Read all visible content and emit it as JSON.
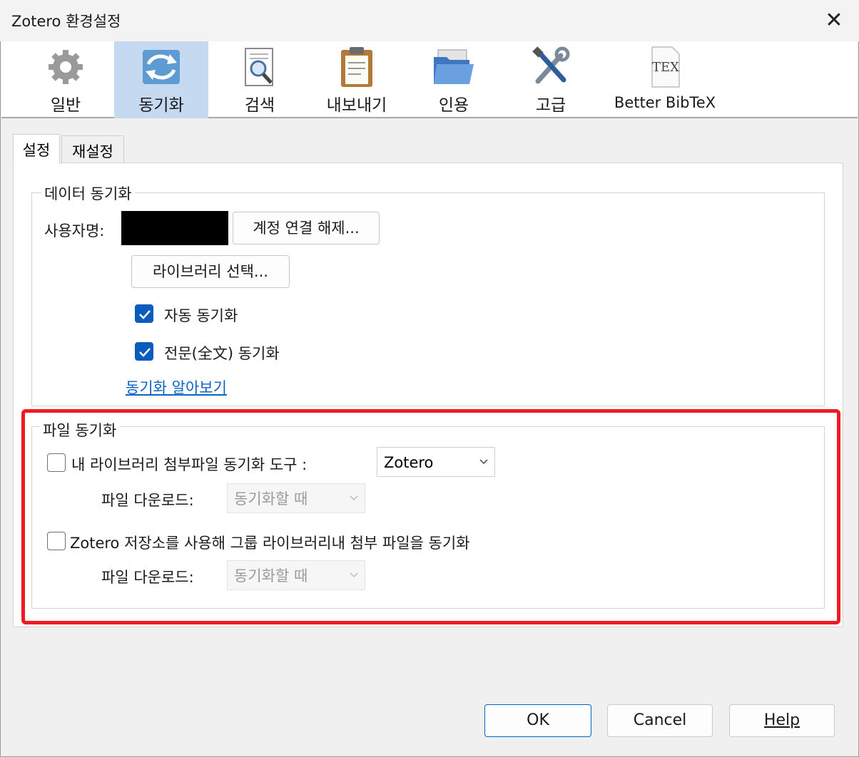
{
  "window": {
    "title": "Zotero 환경설정",
    "close_glyph": "✕"
  },
  "toolbar": {
    "items": [
      {
        "label": "일반",
        "icon": "gear-icon"
      },
      {
        "label": "동기화",
        "icon": "sync-icon"
      },
      {
        "label": "검색",
        "icon": "search-document-icon"
      },
      {
        "label": "내보내기",
        "icon": "clipboard-icon"
      },
      {
        "label": "인용",
        "icon": "folder-icon"
      },
      {
        "label": "고급",
        "icon": "tools-icon"
      },
      {
        "label": "Better BibTeX",
        "icon": "tex-document-icon",
        "icon_text": "TEX"
      }
    ],
    "selected": "동기화"
  },
  "tabs": [
    {
      "label": "설정",
      "active": true
    },
    {
      "label": "재설정",
      "active": false
    }
  ],
  "data_sync": {
    "legend": "데이터 동기화",
    "username_label": "사용자명:",
    "unlink_button": "계정 연결 해제...",
    "choose_libraries_button": "라이브러리 선택...",
    "auto_sync": {
      "label": "자동 동기화",
      "checked": true
    },
    "fulltext_sync": {
      "label": "전문(全文) 동기화",
      "checked": true
    },
    "learn_link": "동기화 알아보기"
  },
  "file_sync": {
    "legend": "파일 동기화",
    "my_library": {
      "label": "내 라이브러리 첨부파일 동기화 도구 :",
      "checked": false,
      "tool_value": "Zotero"
    },
    "download1": {
      "label": "파일 다운로드:",
      "value": "동기화할 때"
    },
    "groups": {
      "label": "Zotero 저장소를 사용해 그룹 라이브러리내 첨부 파일을 동기화",
      "checked": false
    },
    "download2": {
      "label": "파일 다운로드:",
      "value": "동기화할 때"
    }
  },
  "dialog_buttons": {
    "ok": "OK",
    "cancel": "Cancel",
    "help": "Help"
  },
  "colors": {
    "highlight_border": "#ed1c24",
    "selected_toolbar": "#c5d9f0",
    "checkbox_checked": "#0a5cbd",
    "link": "#0b63c5"
  }
}
